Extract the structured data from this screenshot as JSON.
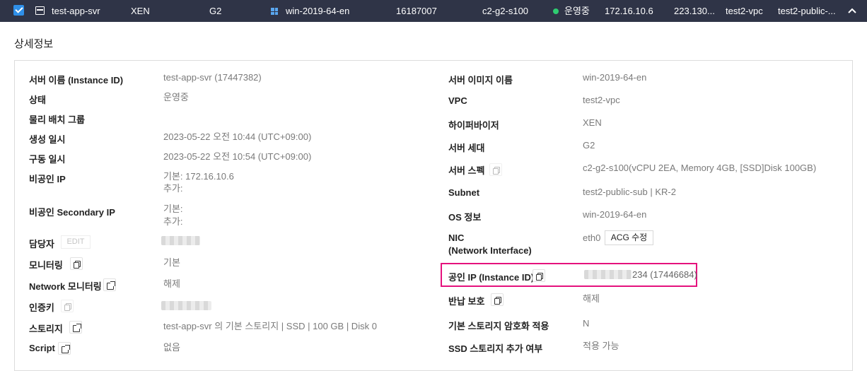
{
  "row": {
    "name": "test-app-svr",
    "hypervisor": "XEN",
    "generation": "G2",
    "image": "win-2019-64-en",
    "instance_no": "16187007",
    "spec": "c2-g2-s100",
    "status": "운영중",
    "private_ip": "172.16.10.6",
    "public_ip": "223.130...",
    "vpc": "test2-vpc",
    "subnet": "test2-public-..."
  },
  "section_title": "상세정보",
  "left": {
    "server_name_label": "서버 이름 (Instance ID)",
    "server_name_value": "test-app-svr (17447382)",
    "status_label": "상태",
    "status_value": "운영중",
    "placement_group_label": "물리 배치 그룹",
    "created_label": "생성 일시",
    "created_value": "2023-05-22 오전 10:44 (UTC+09:00)",
    "started_label": "구동 일시",
    "started_value": "2023-05-22 오전 10:54 (UTC+09:00)",
    "private_ip_label": "비공인 IP",
    "private_ip_default": "기본: 172.16.10.6",
    "private_ip_extra": "추가:",
    "secondary_ip_label": "비공인 Secondary IP",
    "secondary_ip_default": "기본:",
    "secondary_ip_extra": "추가:",
    "owner_label": "담당자",
    "edit_label": "EDIT",
    "monitoring_label": "모니터링",
    "monitoring_value": "기본",
    "network_monitoring_label": "Network 모니터링",
    "network_monitoring_value": "해제",
    "auth_key_label": "인증키",
    "storage_label": "스토리지",
    "storage_value": "test-app-svr 의 기본 스토리지 | SSD | 100 GB | Disk 0",
    "script_label": "Script",
    "script_value": "없음"
  },
  "right": {
    "image_label": "서버 이미지 이름",
    "image_value": "win-2019-64-en",
    "vpc_label": "VPC",
    "vpc_value": "test2-vpc",
    "hypervisor_label": "하이퍼바이저",
    "hypervisor_value": "XEN",
    "generation_label": "서버 세대",
    "generation_value": "G2",
    "spec_label": "서버 스펙",
    "spec_value": "c2-g2-s100(vCPU 2EA, Memory 4GB, [SSD]Disk 100GB)",
    "subnet_label": "Subnet",
    "subnet_value": "test2-public-sub | KR-2",
    "os_label": "OS 정보",
    "os_value": "win-2019-64-en",
    "nic_label": "NIC",
    "nic_label2": "(Network Interface)",
    "nic_value": "eth0",
    "acg_button": "ACG 수정",
    "public_ip_label": "공인 IP (Instance ID)",
    "public_ip_value": "234 (17446684)",
    "return_protect_label": "반납 보호",
    "return_protect_value": "해제",
    "encryption_label": "기본 스토리지 암호화 적용",
    "encryption_value": "N",
    "ssd_add_label": "SSD 스토리지 추가 여부",
    "ssd_add_value": "적용 가능"
  },
  "colors": {
    "header_bg": "#2f3447",
    "accent": "#2f8fe8",
    "status_green": "#2ecc71",
    "highlight": "#e5127d"
  },
  "icons": [
    "checkbox-checked-icon",
    "server-icon",
    "windows-icon",
    "status-dot-icon",
    "chevron-up-icon",
    "copy-icon",
    "external-link-icon"
  ]
}
